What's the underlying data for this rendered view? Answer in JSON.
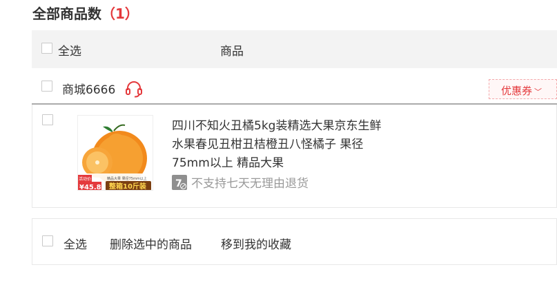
{
  "page": {
    "title_prefix": "全部商品数",
    "title_count": "（1）"
  },
  "header": {
    "select_all_label": "全选",
    "goods_column_label": "商品"
  },
  "shop": {
    "name": "商城6666",
    "coupon_label": "优惠券",
    "coupon_chevron": "﹀"
  },
  "item": {
    "name": "四川不知火丑橘5kg装精选大果京东生鲜水果春见丑柑丑桔橙丑八怪橘子 果径75mm以上 精品大果",
    "thumb_promo_label": "活动价:",
    "thumb_price": "¥45.8",
    "thumb_pack": "整箱10斤装",
    "thumb_tag": "精品大果 果径75mm以上",
    "return_badge_text": "7",
    "return_policy": "不支持七天无理由退货"
  },
  "footer": {
    "select_all_label": "全选",
    "delete_selected_label": "删除选中的商品",
    "move_to_favorites_label": "移到我的收藏"
  },
  "colors": {
    "accent": "#e4393c",
    "header_bg": "#f3f3f3",
    "muted_text": "#999999"
  }
}
